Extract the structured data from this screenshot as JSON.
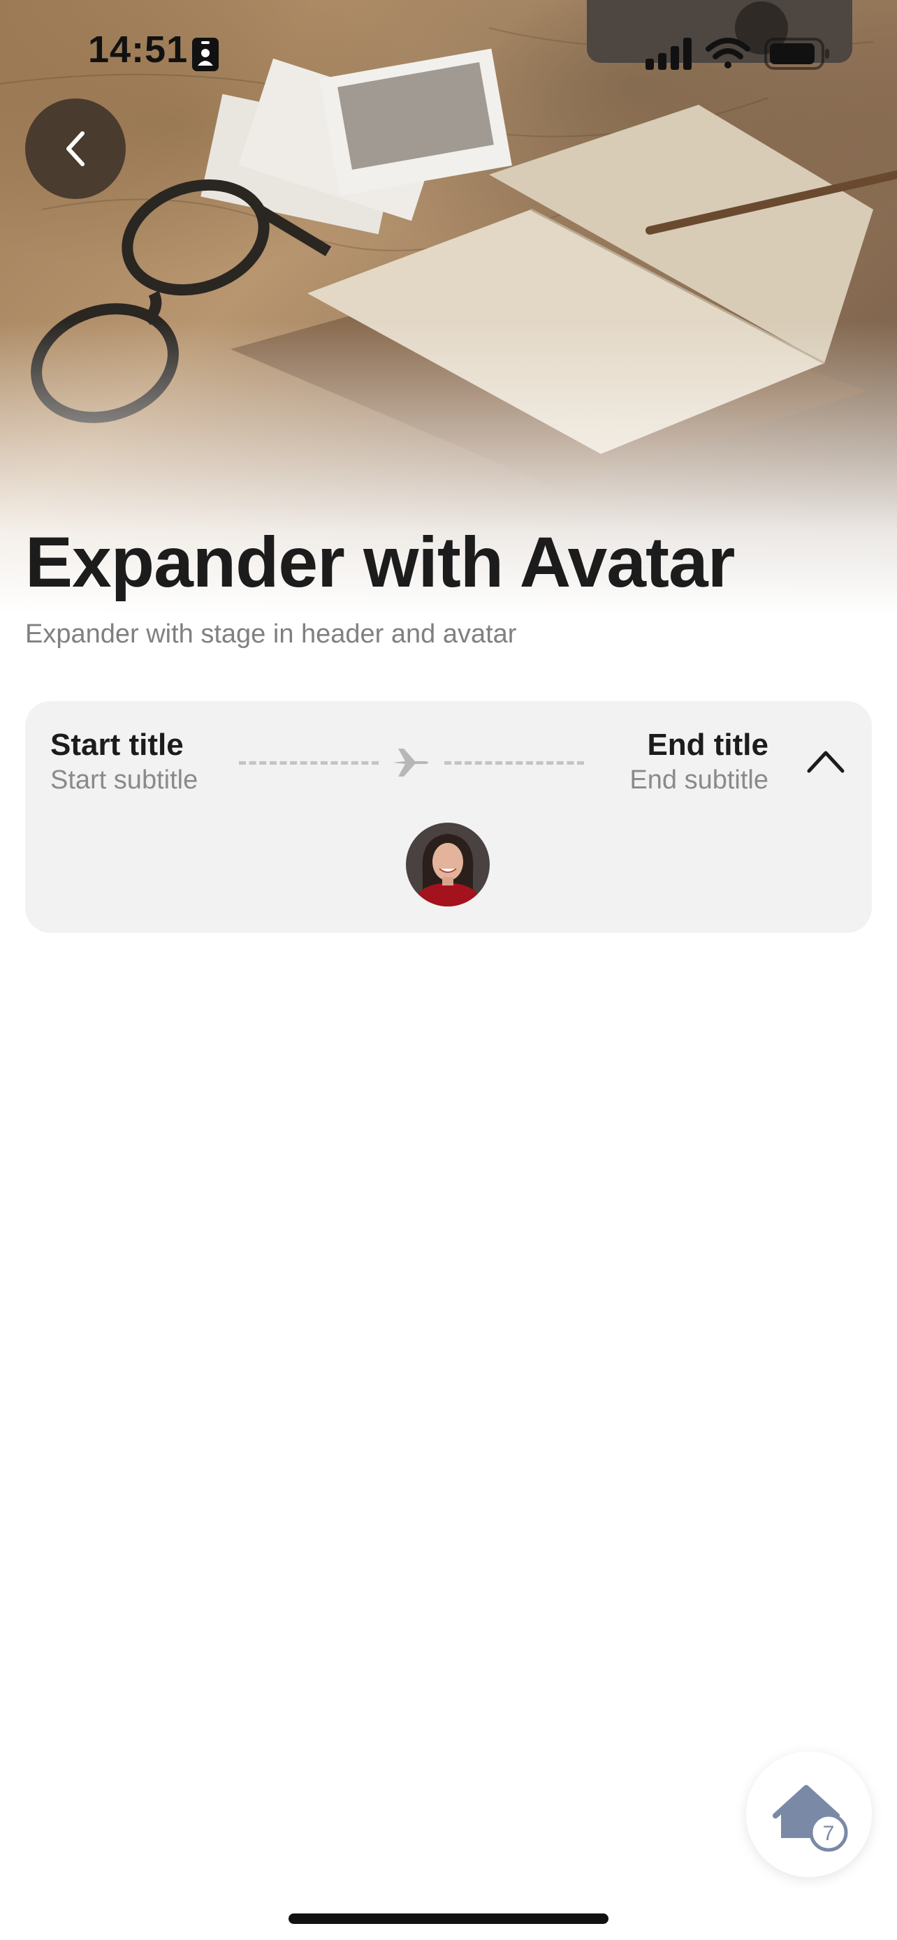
{
  "status_bar": {
    "time": "14:51",
    "icons": [
      "person-badge-icon",
      "cellular-signal-icon",
      "wifi-icon",
      "battery-icon"
    ]
  },
  "header": {
    "back_icon": "chevron-left-icon",
    "title": "Expander with Avatar",
    "subtitle": "Expander with stage in header and avatar"
  },
  "expander": {
    "start_title": "Start title",
    "start_subtitle": "Start subtitle",
    "end_title": "End title",
    "end_subtitle": "End subtitle",
    "route_icon": "airplane-icon",
    "toggle_icon": "chevron-up-icon",
    "expanded": true,
    "avatar_icon": "avatar-photo"
  },
  "home_button": {
    "icon": "home-icon",
    "badge_count": "7"
  },
  "colors": {
    "expander_background": "#f2f2f2",
    "title_text": "#1c1c1c",
    "subtitle_text": "#808080",
    "home_icon": "#7a8aa6"
  }
}
